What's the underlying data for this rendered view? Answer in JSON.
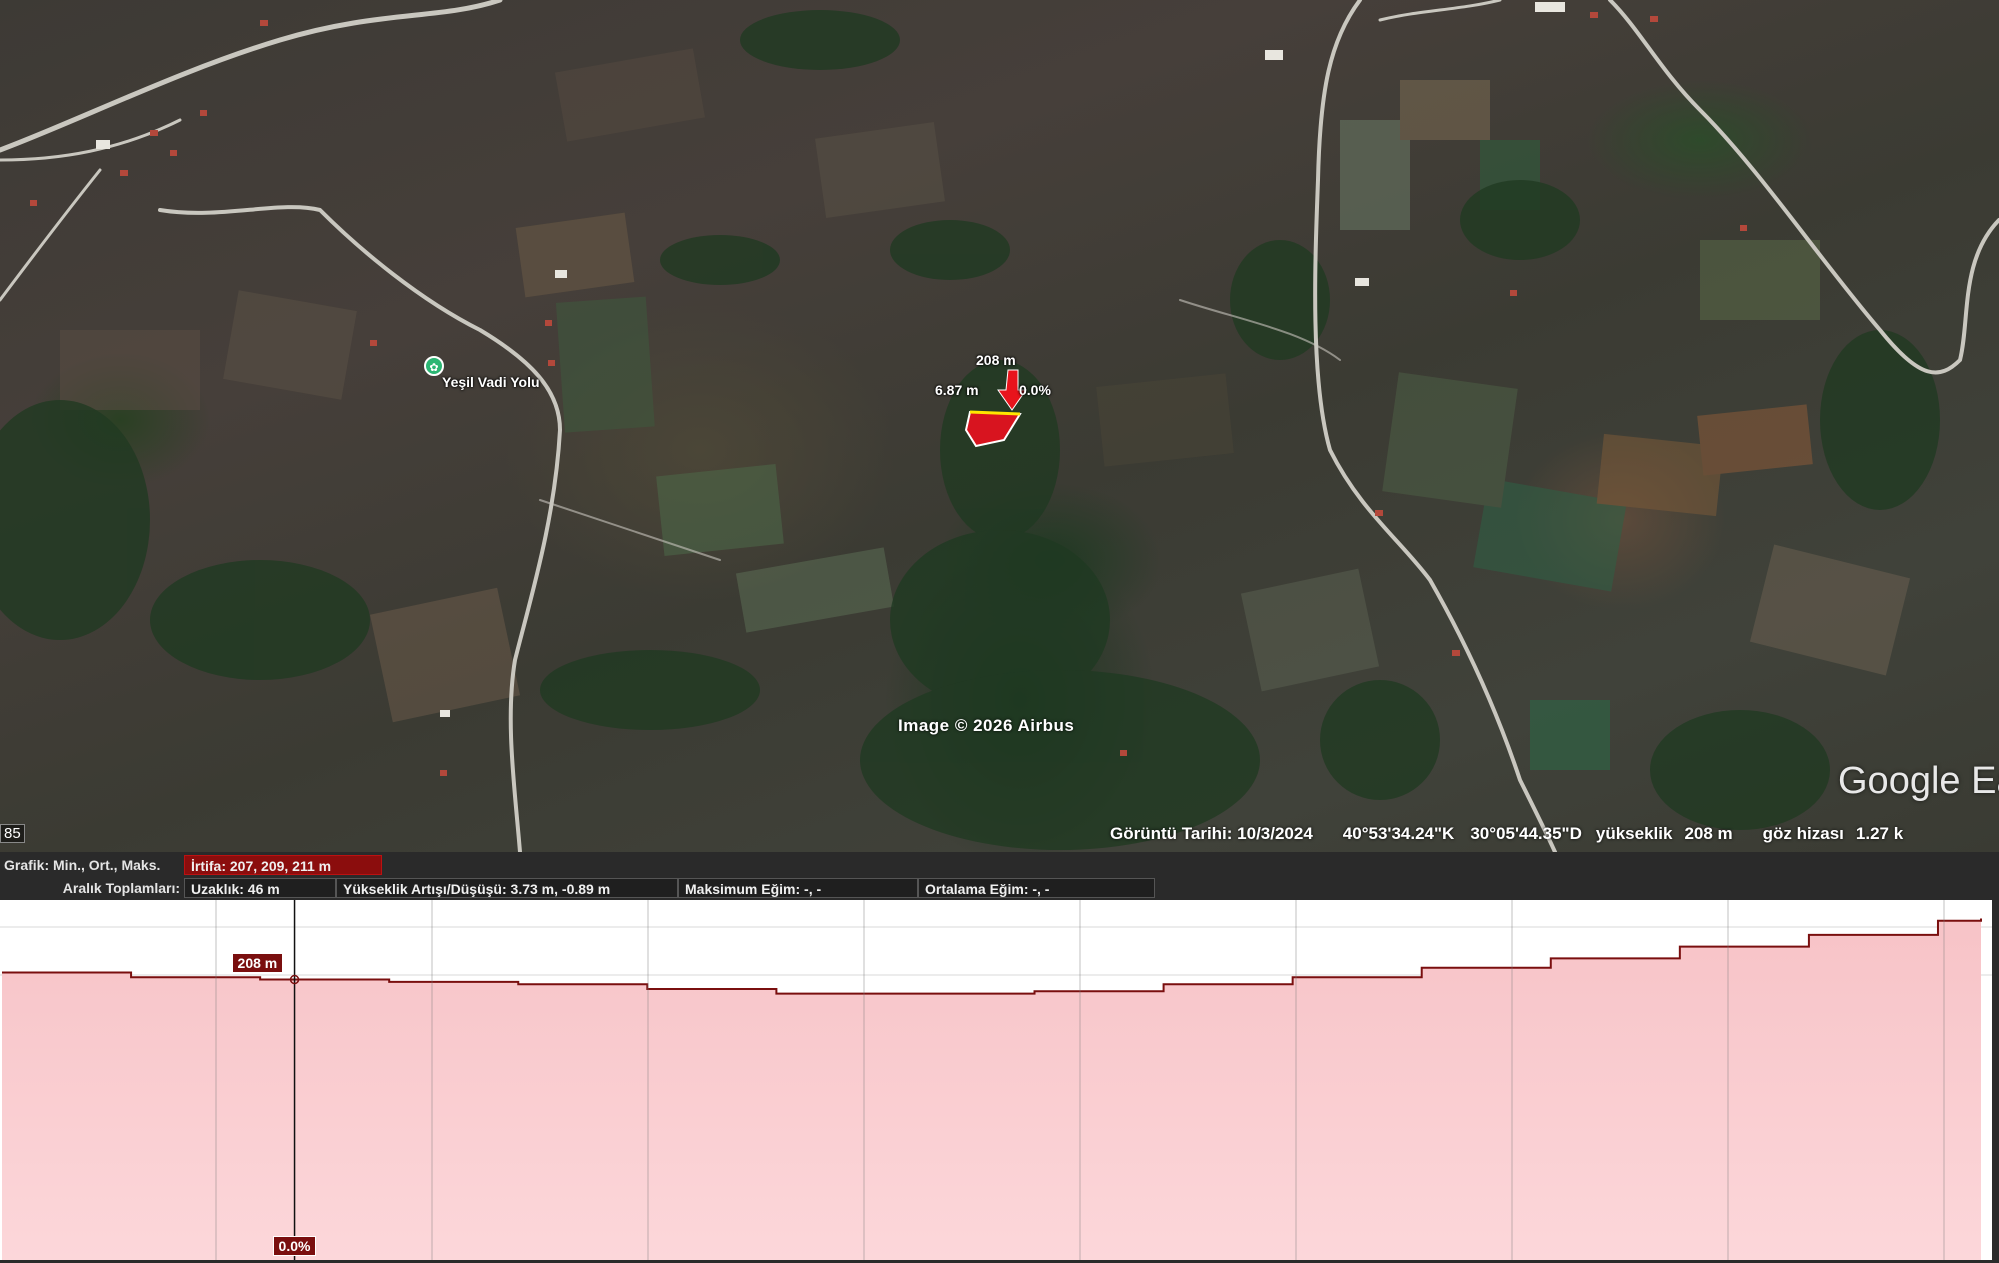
{
  "map": {
    "poi_label": "Yeşil Vadi Yolu",
    "measure": {
      "elevation": "208 m",
      "distance": "6.87 m",
      "slope": "0.0%"
    },
    "watermark": "Image © 2026 Airbus",
    "google_logo": "Google Ea",
    "left_cut_value": "85",
    "status": {
      "image_date": "Görüntü Tarihi: 10/3/2024",
      "latitude": "40°53'34.24\"K",
      "longitude": "30°05'44.35\"D",
      "elevation_label": "yükseklik",
      "elevation_value": "208 m",
      "eye_label": "göz hizası",
      "eye_value": "1.27 k"
    }
  },
  "profile": {
    "graph_label": "Grafik: Min., Ort., Maks.",
    "altitude_values": "İrtifa: 207, 209, 211 m",
    "range_label": "Aralık Toplamları:",
    "distance": "Uzaklık: 46 m",
    "elevation_gain_loss": "Yükseklik Artışı/Düşüşü: 3.73 m, -0.89 m",
    "max_slope": "Maksimum Eğim: -, -",
    "avg_slope": "Ortalama Eğim: -, -",
    "cursor_elevation": "208 m",
    "cursor_slope": "0.0%"
  },
  "chart_data": {
    "type": "area",
    "title": "",
    "xlabel": "",
    "ylabel": "",
    "ylim": [
      207,
      211
    ],
    "x": [
      0,
      3,
      6,
      9,
      12,
      15,
      18,
      21,
      24,
      27,
      30,
      33,
      36,
      39,
      42,
      45,
      46
    ],
    "series": [
      {
        "name": "İrtifa",
        "values": [
          208.0,
          207.8,
          207.7,
          207.6,
          207.5,
          207.3,
          207.1,
          207.1,
          207.2,
          207.5,
          207.8,
          208.2,
          208.6,
          209.1,
          209.6,
          210.2,
          210.3
        ]
      }
    ],
    "cursor_x": 6.8,
    "colors": {
      "line": "#7a0f0f",
      "fill_top": "#f7c3c7",
      "fill_bottom": "#fcd7da",
      "tag": "#7a0f0f"
    }
  }
}
